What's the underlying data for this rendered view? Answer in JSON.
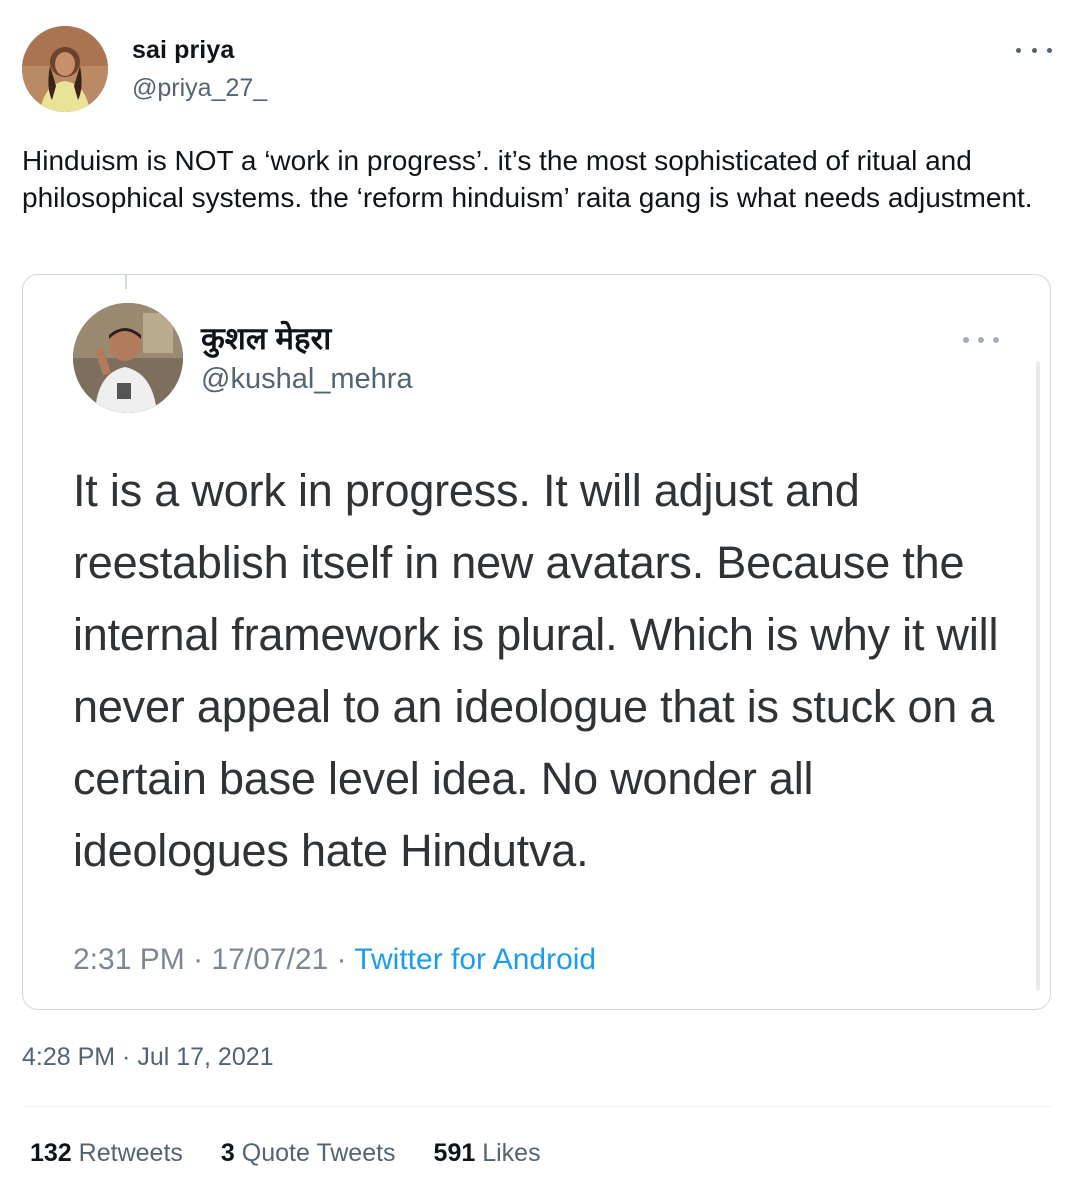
{
  "author": {
    "name": "sai priya",
    "handle": "@priya_27_"
  },
  "tweet": {
    "text": "Hinduism is NOT a ‘work in progress’. it’s the most sophisticated of ritual and philosophical systems. the ‘reform hinduism’ raita gang is what needs adjustment."
  },
  "quoted": {
    "name": "कुशल मेहरा",
    "handle": "@kushal_mehra",
    "text": "It is a work in progress. It will adjust and reestablish itself in new avatars. Because the internal framework is plural. Which is why it will never appeal to an ideologue that is stuck on a certain base level idea. No wonder all ideologues hate Hindutva.",
    "time": "2:31 PM",
    "date": "17/07/21",
    "separator": "·",
    "source": "Twitter for Android"
  },
  "timestamp": "4:28 PM · Jul 17, 2021",
  "stats": {
    "retweets_count": "132",
    "retweets_label": "Retweets",
    "quotes_count": "3",
    "quotes_label": "Quote Tweets",
    "likes_count": "591",
    "likes_label": "Likes"
  },
  "icons": {
    "more": "more-horizontal-icon"
  },
  "colors": {
    "text_primary": "#0f1419",
    "text_secondary": "#536471",
    "link": "#1d9bf0",
    "border": "#cfd9de"
  }
}
